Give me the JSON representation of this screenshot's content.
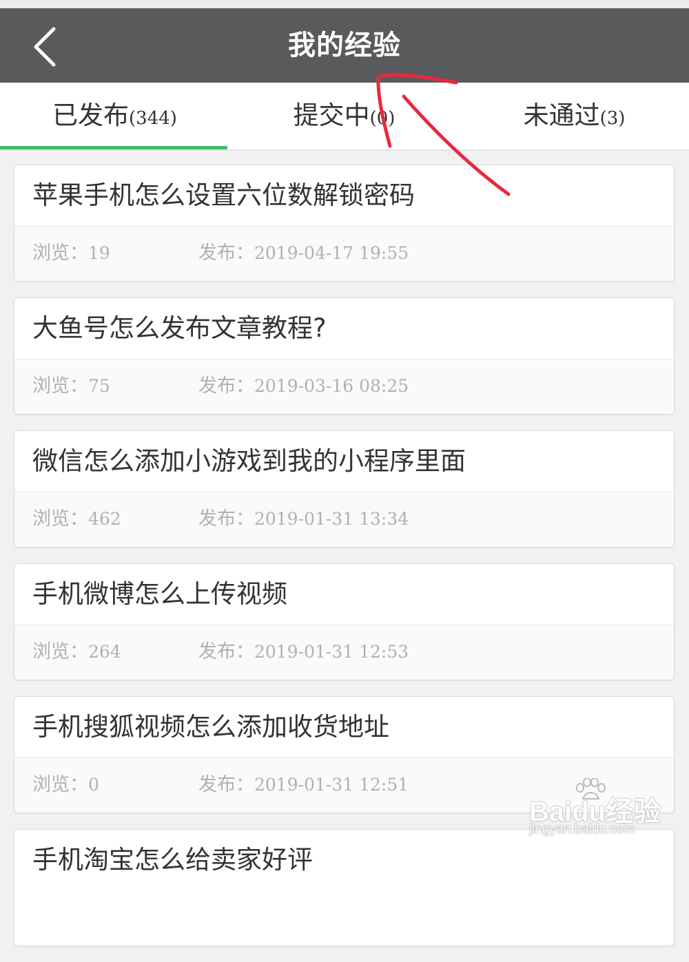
{
  "header": {
    "title": "我的经验",
    "back_icon": "chevron-left-icon"
  },
  "tabs": [
    {
      "label": "已发布",
      "count": "(344)",
      "active": true
    },
    {
      "label": "提交中",
      "count": "(0)",
      "active": false
    },
    {
      "label": "未通过",
      "count": "(3)",
      "active": false
    }
  ],
  "articles": [
    {
      "title": "苹果手机怎么设置六位数解锁密码",
      "views_label": "浏览：",
      "views": "19",
      "date_label": "发布：",
      "date": "2019-04-17 19:55"
    },
    {
      "title": "大鱼号怎么发布文章教程?",
      "views_label": "浏览：",
      "views": "75",
      "date_label": "发布：",
      "date": "2019-03-16 08:25"
    },
    {
      "title": "微信怎么添加小游戏到我的小程序里面",
      "views_label": "浏览：",
      "views": "462",
      "date_label": "发布：",
      "date": "2019-01-31 13:34"
    },
    {
      "title": "手机微博怎么上传视频",
      "views_label": "浏览：",
      "views": "264",
      "date_label": "发布：",
      "date": "2019-01-31 12:53"
    },
    {
      "title": "手机搜狐视频怎么添加收货地址",
      "views_label": "浏览：",
      "views": "0",
      "date_label": "发布：",
      "date": "2019-01-31 12:51"
    },
    {
      "title": "手机淘宝怎么给卖家好评",
      "views_label": "",
      "views": "",
      "date_label": "",
      "date": ""
    }
  ],
  "watermark": {
    "logo": "Baidu经验",
    "url": "jingyan.baidu.com"
  },
  "colors": {
    "header_bg": "#595a5c",
    "active_tab_indicator": "#42b96b",
    "annotation_arrow": "#e8283f"
  }
}
